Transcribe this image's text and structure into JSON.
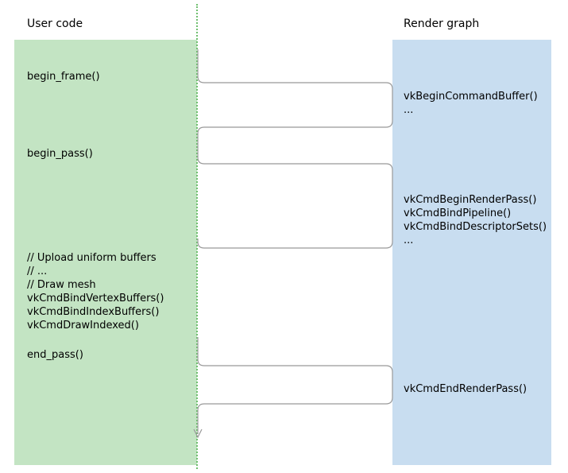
{
  "headers": {
    "left": "User code",
    "right": "Render graph"
  },
  "left_blocks": {
    "begin_frame": "begin_frame()",
    "begin_pass": "begin_pass()",
    "draw_block_l1": "// Upload uniform buffers",
    "draw_block_l2": "// ...",
    "draw_block_l3": "// Draw mesh",
    "draw_block_l4": "vkCmdBindVertexBuffers()",
    "draw_block_l5": "vkCmdBindIndexBuffers()",
    "draw_block_l6": "vkCmdDrawIndexed()",
    "end_pass": "end_pass()"
  },
  "right_blocks": {
    "cmd_buffer_l1": "vkBeginCommandBuffer()",
    "cmd_buffer_l2": "...",
    "render_pass_l1": "vkCmdBeginRenderPass()",
    "render_pass_l2": "vkCmdBindPipeline()",
    "render_pass_l3": "vkCmdBindDescriptorSets()",
    "render_pass_l4": "...",
    "end_render_pass": "vkCmdEndRenderPass()"
  },
  "colors": {
    "left_bg": "#c3e4c3",
    "right_bg": "#c8ddf0",
    "timeline": "#6fbf6f",
    "flow_stroke": "#999999"
  }
}
